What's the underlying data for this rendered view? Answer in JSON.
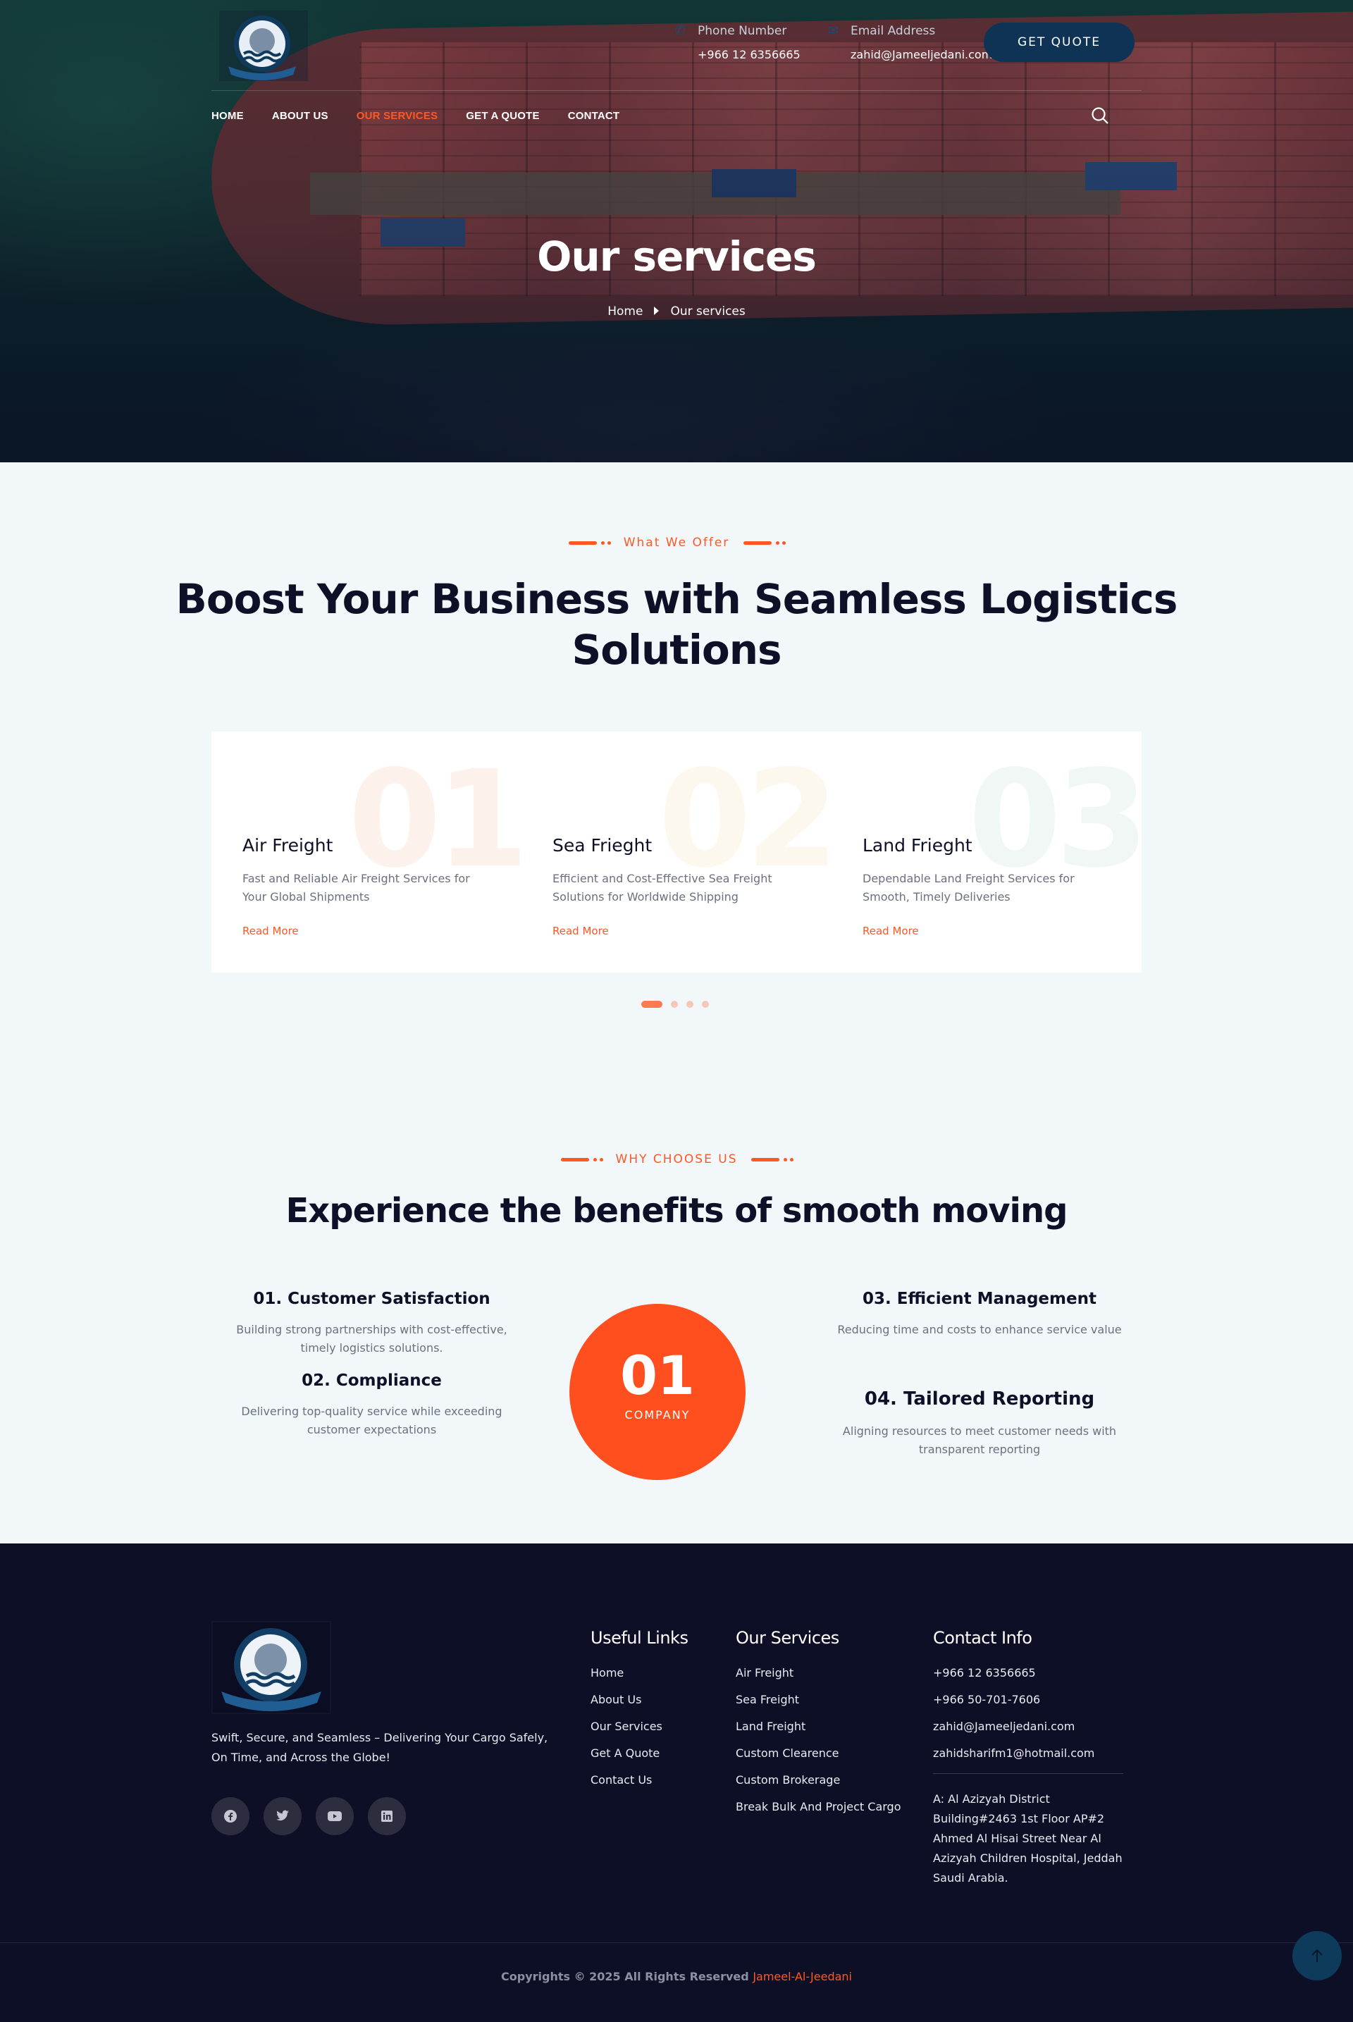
{
  "header": {
    "phone_label": "Phone Number",
    "phone_value": "+966 12 6356665",
    "email_label": "Email Address",
    "email_value": "zahid@Jameeljedani.com",
    "quote_button": "GET QUOTE"
  },
  "nav": {
    "items": [
      {
        "label": "HOME"
      },
      {
        "label": "ABOUT US"
      },
      {
        "label": "OUR SERVICES"
      },
      {
        "label": "GET A QUOTE"
      },
      {
        "label": "CONTACT"
      }
    ],
    "active": "OUR SERVICES",
    "active_color": "#ff5722"
  },
  "hero": {
    "title": "Our services",
    "breadcrumb_home": "Home",
    "breadcrumb_current": "Our services"
  },
  "services": {
    "eyebrow": "What We Offer",
    "heading_line1": "Boost Your Business with Seamless Logistics",
    "heading_line2": "Solutions",
    "items": [
      {
        "num": "01",
        "title": "Air Freight",
        "desc": "Fast and Reliable Air Freight Services for Your Global Shipments",
        "link": "Read More"
      },
      {
        "num": "02",
        "title": "Sea Frieght",
        "desc": "Efficient and Cost-Effective Sea Freight Solutions for Worldwide Shipping",
        "link": "Read More"
      },
      {
        "num": "03",
        "title": "Land Frieght",
        "desc": "Dependable Land Freight Services for Smooth, Timely Deliveries",
        "link": "Read More"
      }
    ],
    "carousel_pages": 4,
    "carousel_active": 1
  },
  "why": {
    "eyebrow": "WHY CHOOSE US",
    "heading": "Experience the benefits of smooth moving",
    "features": [
      {
        "title": "01. Customer Satisfaction",
        "desc": "Building strong partnerships with cost-effective, timely logistics solutions."
      },
      {
        "title": "02. Compliance",
        "desc": "Delivering top-quality service while exceeding customer expectations"
      },
      {
        "title": "03. Efficient Management",
        "desc": "Reducing time and costs to enhance service value"
      },
      {
        "title": "04. Tailored Reporting",
        "desc": "Aligning resources to meet customer needs with transparent reporting"
      }
    ],
    "circle_number": "01",
    "circle_label": "COMPANY",
    "accent_color": "#ff4f1f"
  },
  "footer": {
    "tagline": "Swift, Secure, and Seamless – Delivering Your Cargo Safely, On Time, and Across the Globe!",
    "socials": [
      "facebook-icon",
      "twitter-icon",
      "youtube-icon",
      "linkedin-icon"
    ],
    "useful_links_title": "Useful Links",
    "useful_links": [
      "Home",
      "About Us",
      "Our Services",
      "Get A Quote",
      "Contact Us"
    ],
    "services_title": "Our Services",
    "services_links": [
      "Air Freight",
      "Sea Freight",
      "Land Freight",
      "Custom Clearence",
      "Custom Brokerage",
      "Break Bulk And Project Cargo"
    ],
    "contact_title": "Contact Info",
    "contact": [
      "+966 12 6356665",
      "+966 50-701-7606",
      "zahid@Jameeljedani.com",
      "zahidsharifm1@hotmail.com"
    ],
    "address": "A: Al Azizyah District Building#2463 1st Floor AP#2 Ahmed Al Hisai Street Near Al Azizyah Children Hospital, Jeddah Saudi Arabia.",
    "copyright": "Copyrights © 2025 All Rights Reserved",
    "brand": "Jameel-Al-Jeedani"
  }
}
